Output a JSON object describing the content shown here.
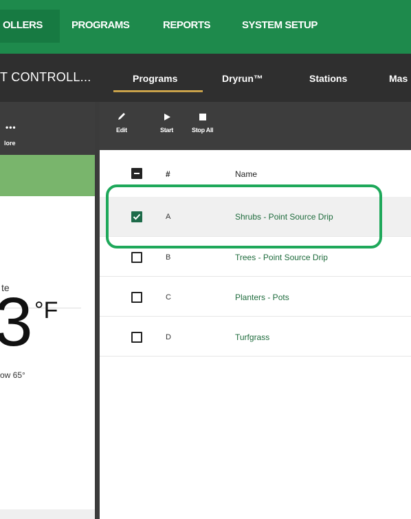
{
  "top_nav": {
    "items": [
      "OLLERS",
      "PROGRAMS",
      "REPORTS",
      "SYSTEM SETUP"
    ]
  },
  "sub_nav": {
    "controller_label": "T CONTROLL...",
    "tabs": [
      "Programs",
      "Dryrun™",
      "Stations",
      "Mas"
    ]
  },
  "left_panel": {
    "more_label": "lore",
    "text_te": "te",
    "temperature": "3",
    "unit": "°F",
    "low": "ow 65°"
  },
  "toolbar": {
    "edit_label": "Edit",
    "start_label": "Start",
    "stop_all_label": "Stop All"
  },
  "table": {
    "headers": {
      "number": "#",
      "name": "Name"
    },
    "rows": [
      {
        "id": "A",
        "name": "Shrubs - Point Source Drip",
        "checked": true
      },
      {
        "id": "B",
        "name": "Trees - Point Source Drip",
        "checked": false
      },
      {
        "id": "C",
        "name": "Planters - Pots",
        "checked": false
      },
      {
        "id": "D",
        "name": "Turfgrass",
        "checked": false
      }
    ]
  },
  "colors": {
    "brand_green": "#1e8a4c",
    "highlight": "#1ea85a",
    "link_green": "#1e6b3c"
  }
}
